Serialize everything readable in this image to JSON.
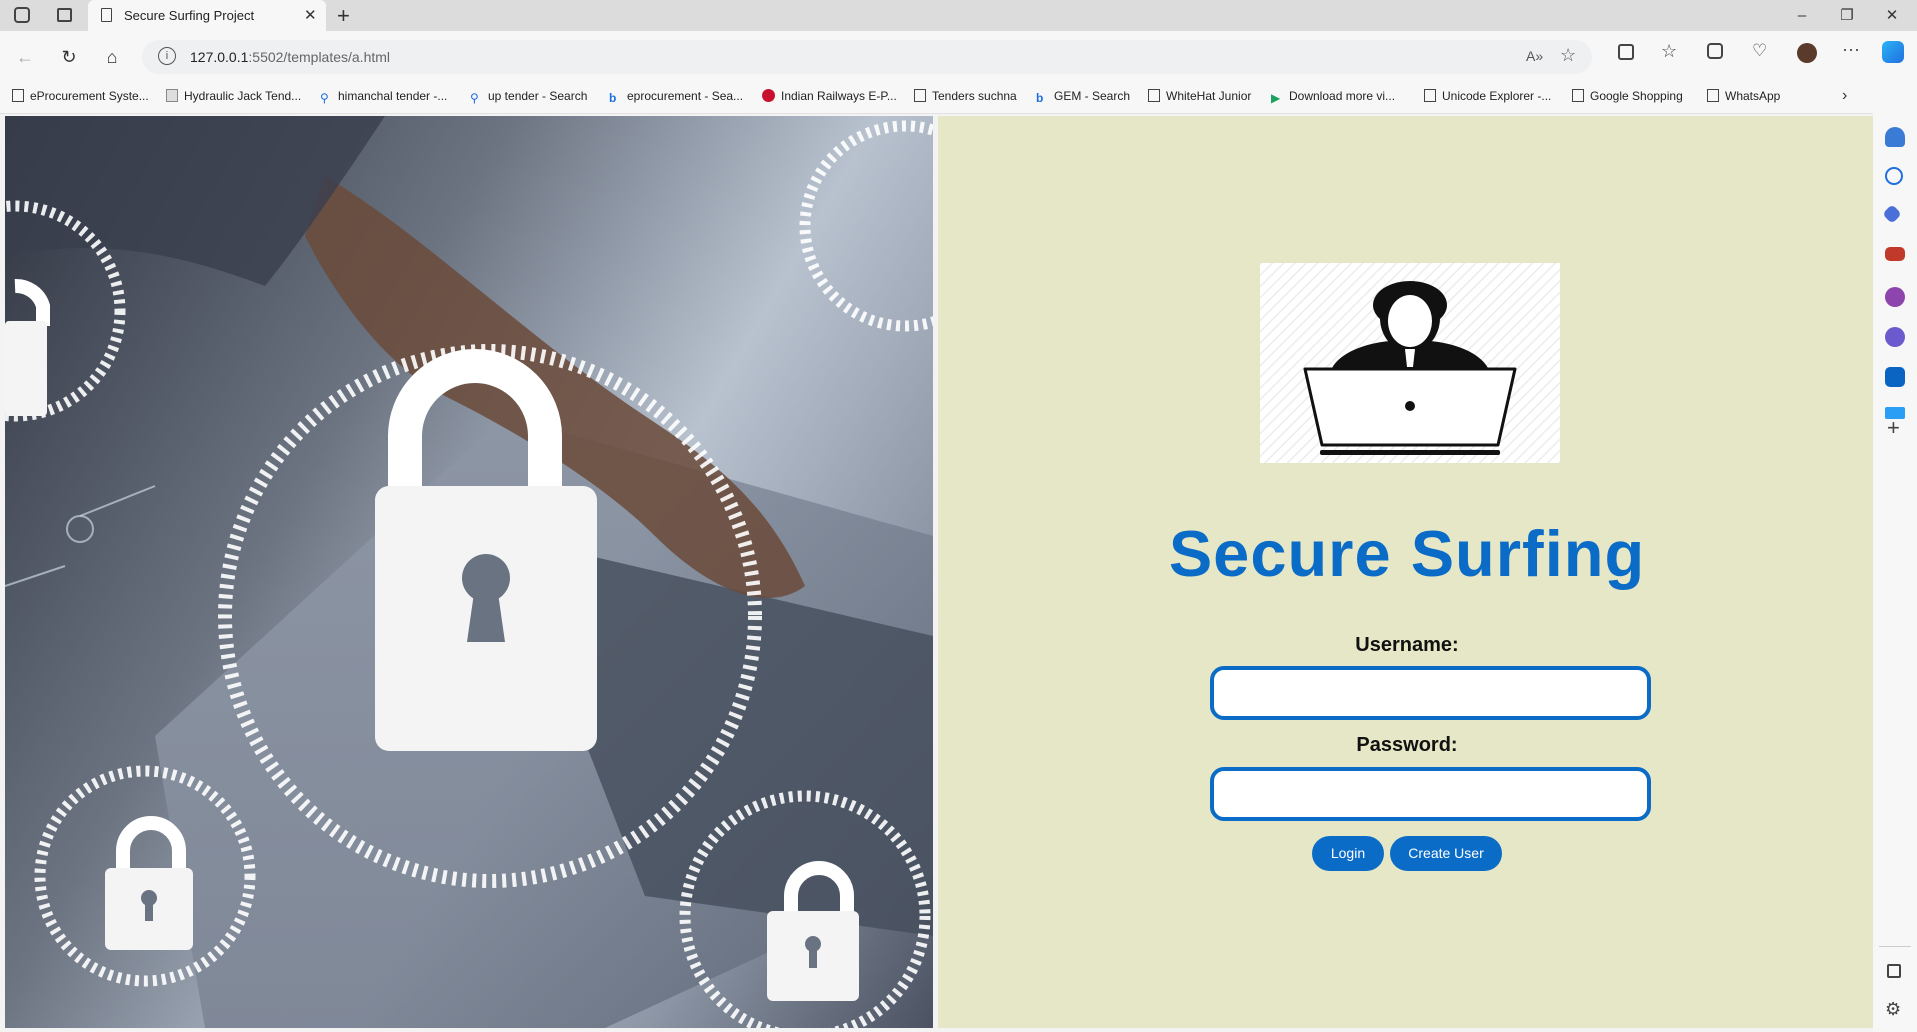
{
  "browser": {
    "tab_title": "Secure Surfing Project",
    "url_host": "127.0.0.1",
    "url_rest": ":5502/templates/a.html",
    "bookmarks": [
      {
        "label": "eProcurement Syste...",
        "icon": "page-icon"
      },
      {
        "label": "Hydraulic Jack Tend...",
        "icon": "image-icon"
      },
      {
        "label": "himanchal tender -...",
        "icon": "search-icon"
      },
      {
        "label": "up tender - Search",
        "icon": "search-icon"
      },
      {
        "label": "eprocurement - Sea...",
        "icon": "bing-icon"
      },
      {
        "label": "Indian Railways E-P...",
        "icon": "railways-icon"
      },
      {
        "label": "Tenders suchna",
        "icon": "page-icon"
      },
      {
        "label": "GEM - Search",
        "icon": "bing-icon"
      },
      {
        "label": "WhiteHat Junior",
        "icon": "page-icon"
      },
      {
        "label": "Download more vi...",
        "icon": "play-icon"
      },
      {
        "label": "Unicode Explorer -...",
        "icon": "page-icon"
      },
      {
        "label": "Google Shopping",
        "icon": "page-icon"
      },
      {
        "label": "WhatsApp",
        "icon": "page-icon"
      }
    ]
  },
  "login": {
    "title": "Secure Surfing",
    "username_label": "Username:",
    "password_label": "Password:",
    "username_value": "",
    "password_value": "",
    "login_button": "Login",
    "create_button": "Create User"
  },
  "colors": {
    "accent": "#0b6cc7",
    "panel_bg": "#e6e7c6"
  }
}
